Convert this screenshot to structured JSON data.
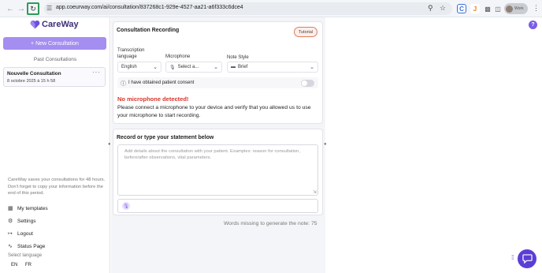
{
  "browser": {
    "url": "app.coeurway.com/ai/consultation/837268c1-929e-4527-aa21-a6f333c6dce4",
    "profile_name": "Work"
  },
  "sidebar": {
    "logo_text": "CareWay",
    "new_consultation": "+ New Consultation",
    "past_title": "Past Consultations",
    "consultation": {
      "name": "Nouvelle Consultation",
      "date": "8 octobre 2025 à 15 h 58",
      "more": "···"
    },
    "notice": "CareWay saves your consultations for 48 hours. Don't forget to copy your information before the end of this period.",
    "nav": [
      {
        "label": "My templates",
        "icon": "templates-icon"
      },
      {
        "label": "Settings",
        "icon": "gear-icon"
      },
      {
        "label": "Logout",
        "icon": "logout-icon"
      },
      {
        "label": "Status Page",
        "icon": "activity-icon"
      }
    ],
    "language_title": "Select language",
    "languages": [
      "EN",
      "FR"
    ]
  },
  "recording": {
    "title": "Consultation Recording",
    "tutorial": "Tutorial",
    "transcription_label": "Transcription language",
    "transcription_value": "English",
    "microphone_label": "Microphone",
    "microphone_value": "Select a...",
    "note_style_label": "Note Style",
    "note_style_value": "Brief",
    "consent_text": "I have obtained patient consent",
    "error_title": "No microphone detected!",
    "error_text": "Please connect a microphone to your device and verify that you allowed us to use your microphone to start recording."
  },
  "statement": {
    "title": "Record or type your statement below",
    "placeholder": "Add details about the consultation with your patient. Examples: reason for consultation, before/after observations, vital parameters."
  },
  "footer": {
    "words_missing": "Words missing to generate the note: 75"
  },
  "colors": {
    "accent": "#7b5ee6",
    "new_button": "#a48ef0",
    "error": "#d9342b",
    "reload_highlight": "#2f9a5a"
  }
}
